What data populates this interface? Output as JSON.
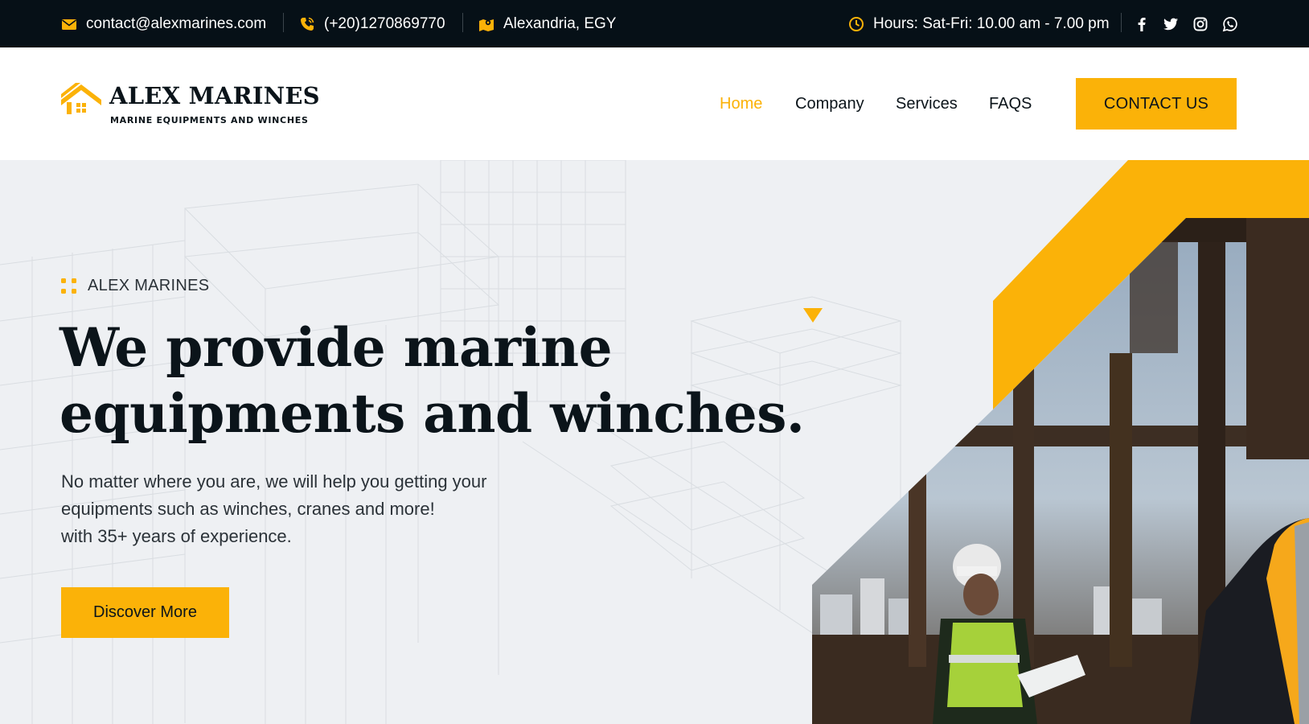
{
  "topbar": {
    "email": "contact@alexmarines.com",
    "phone": "(+20)1270869770",
    "location": "Alexandria, EGY",
    "hours": "Hours: Sat-Fri: 10.00 am - 7.00 pm",
    "icons": [
      "envelope-icon",
      "phone-icon",
      "map-icon",
      "clock-icon"
    ],
    "social": [
      "facebook-icon",
      "twitter-icon",
      "instagram-icon",
      "whatsapp-icon"
    ]
  },
  "logo": {
    "name": "ALEX MARINES",
    "tagline": "MARINE EQUIPMENTS AND WINCHES",
    "icon": "house-icon"
  },
  "nav": {
    "items": [
      {
        "label": "Home",
        "active": true
      },
      {
        "label": "Company",
        "active": false
      },
      {
        "label": "Services",
        "active": false
      },
      {
        "label": "FAQS",
        "active": false
      }
    ],
    "cta_label": "CONTACT US"
  },
  "hero": {
    "eyebrow": "ALEX MARINES",
    "headline_lines": [
      "We provide marine",
      "equipments and winches."
    ],
    "description_lines": [
      "No matter where you are, we will help you getting your",
      "equipments such as winches, cranes and more!",
      "with 35+ years of experience."
    ],
    "button_label": "Discover More"
  },
  "colors": {
    "accent": "#fbb208",
    "dark": "#061017",
    "hero_bg": "#eef0f3",
    "text": "#0b141a"
  }
}
